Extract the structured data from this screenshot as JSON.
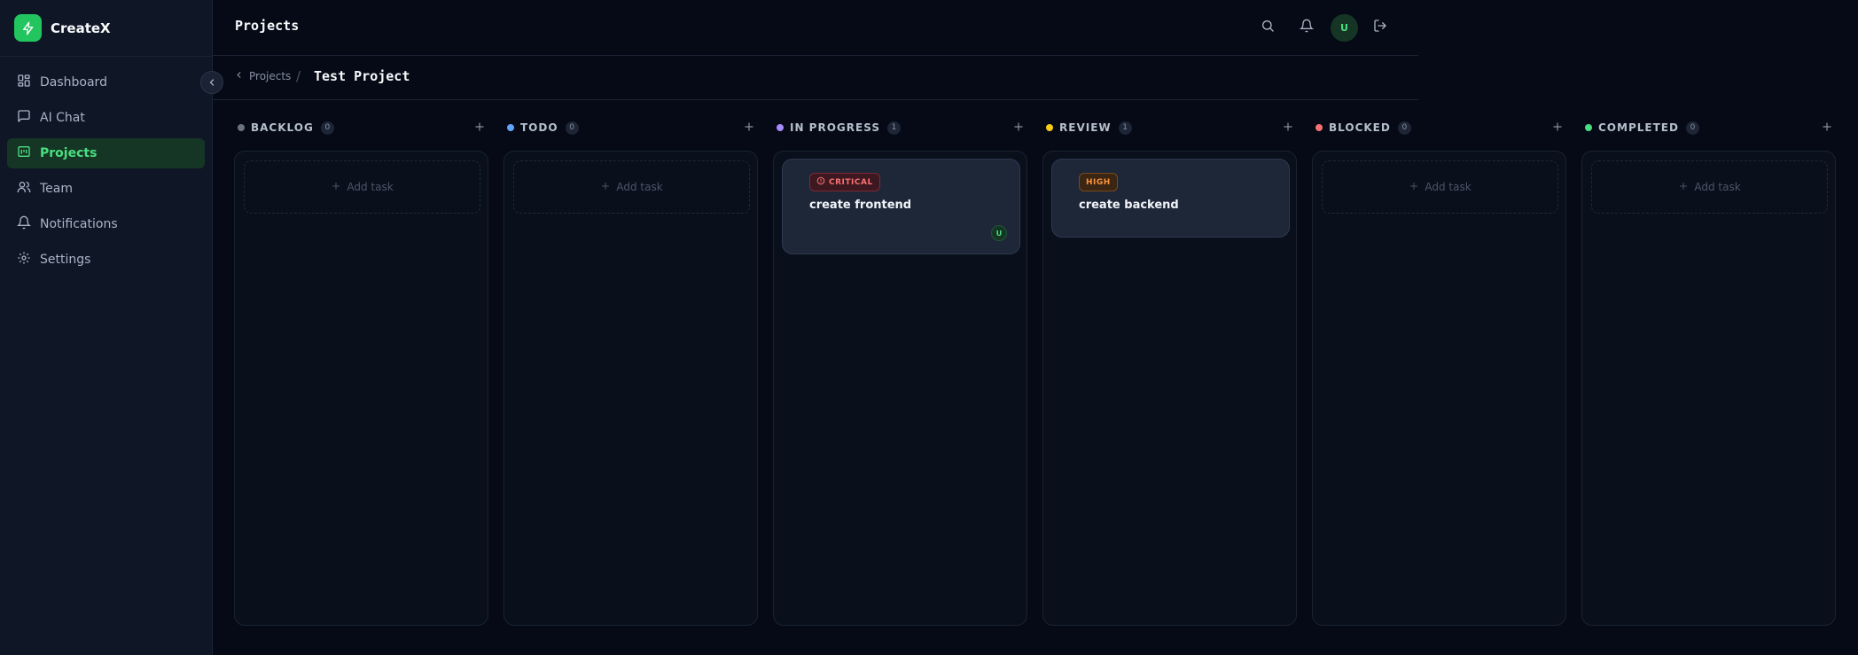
{
  "brand": {
    "name": "CreateX"
  },
  "sidebar": {
    "items": [
      {
        "label": "Dashboard",
        "icon": "dashboard-icon",
        "active": false
      },
      {
        "label": "AI Chat",
        "icon": "chat-icon",
        "active": false
      },
      {
        "label": "Projects",
        "icon": "projects-icon",
        "active": true
      },
      {
        "label": "Team",
        "icon": "team-icon",
        "active": false
      },
      {
        "label": "Notifications",
        "icon": "bell-icon",
        "active": false
      },
      {
        "label": "Settings",
        "icon": "gear-icon",
        "active": false
      }
    ]
  },
  "header": {
    "title": "Projects",
    "avatar_initial": "U"
  },
  "breadcrumb": {
    "back_label": "Projects",
    "separator": "/",
    "current": "Test Project"
  },
  "board": {
    "add_task_label": "Add task",
    "columns": [
      {
        "title": "BACKLOG",
        "count": "0",
        "color": "#6b7280"
      },
      {
        "title": "TODO",
        "count": "0",
        "color": "#60a5fa"
      },
      {
        "title": "IN PROGRESS",
        "count": "1",
        "color": "#a78bfa"
      },
      {
        "title": "REVIEW",
        "count": "1",
        "color": "#facc15"
      },
      {
        "title": "BLOCKED",
        "count": "0",
        "color": "#f87171"
      },
      {
        "title": "COMPLETED",
        "count": "0",
        "color": "#4ade80"
      }
    ],
    "tasks": [
      {
        "priority": "CRITICAL",
        "title": "create frontend",
        "assignee": "U"
      },
      {
        "priority": "HIGH",
        "title": "create backend"
      }
    ]
  },
  "colors": {
    "accent": "#22c55e",
    "background": "#060a16",
    "sidebar": "#0f1626"
  }
}
